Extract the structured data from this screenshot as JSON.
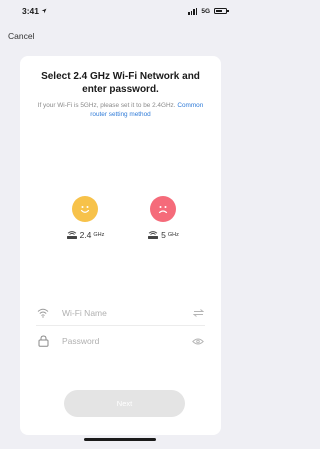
{
  "status_bar": {
    "time": "3:41",
    "network": "5G"
  },
  "nav": {
    "cancel_label": "Cancel"
  },
  "card": {
    "title": "Select 2.4 GHz Wi-Fi Network and enter password.",
    "hint_text": "If your Wi-Fi is 5GHz, please set it to be 2.4GHz.",
    "hint_link": "Common router setting method",
    "bands": [
      {
        "label_main": "2.4",
        "label_unit": "GHz",
        "face": "happy-face-icon"
      },
      {
        "label_main": "5",
        "label_unit": "GHz",
        "face": "sad-face-icon"
      }
    ],
    "wifi_field": {
      "placeholder": "Wi-Fi Name",
      "value": ""
    },
    "password_field": {
      "placeholder": "Password",
      "value": ""
    },
    "next_label": "Next"
  },
  "colors": {
    "background": "#efeff4",
    "link": "#2f7bd8",
    "happy_face": "#f7c24a",
    "sad_face": "#f56b7a",
    "next_button_disabled": "#e4e4e4"
  }
}
